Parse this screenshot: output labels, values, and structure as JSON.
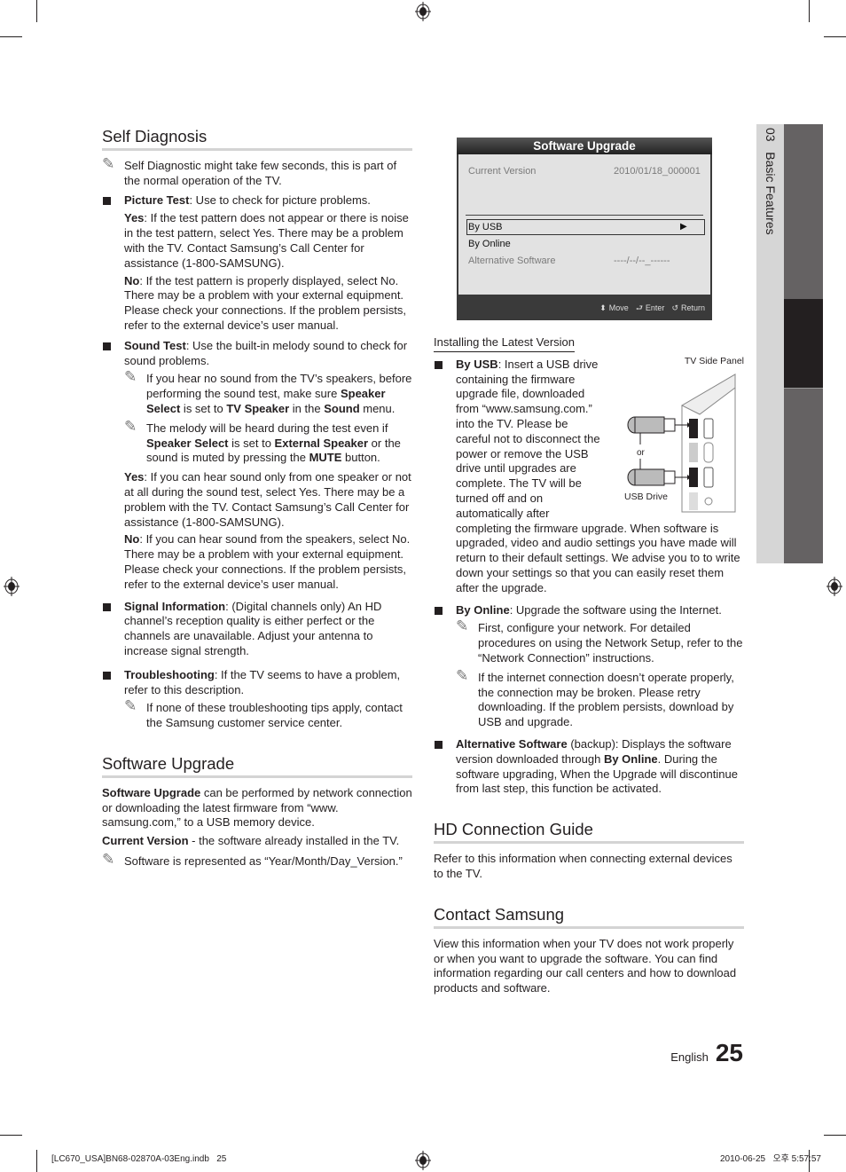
{
  "side_tab": {
    "chapter": "03",
    "title": "Basic Features"
  },
  "self_diagnosis": {
    "heading": "Self Diagnosis",
    "note": "Self Diagnostic might take few seconds, this is part of the normal operation of the TV.",
    "picture_test": {
      "label": "Picture Test",
      "desc": ": Use to check for picture problems.",
      "yes_label": "Yes",
      "yes_text": ": If the test pattern does not appear or there is noise in the test pattern, select Yes. There may be a problem with the TV. Contact Samsung’s Call Center for assistance (1-800-SAMSUNG).",
      "no_label": "No",
      "no_text": ": If the test pattern is properly displayed, select No. There may be a problem with your external equipment. Please check your connections. If the problem persists, refer to the external device’s user manual."
    },
    "sound_test": {
      "label": "Sound Test",
      "desc": ": Use the built-in melody sound to check for sound problems.",
      "note1": {
        "t1": "If you hear no sound from the TV’s speakers, before performing the sound test, make sure ",
        "b1": "Speaker Select",
        "t2": " is set to ",
        "b2": "TV Speaker",
        "t3": " in the ",
        "b3": "Sound",
        "t4": " menu."
      },
      "note2": {
        "t1": "The melody will be heard during the test even if ",
        "b1": "Speaker Select",
        "t2": " is set to ",
        "b2": "External Speaker",
        "t3": " or the sound is muted by pressing the ",
        "b3": "MUTE",
        "t4": " button."
      },
      "yes_label": "Yes",
      "yes_text": ": If you can hear sound only from one speaker or not at all during the sound test, select Yes. There may be a problem with the TV. Contact Samsung’s Call Center for assistance (1-800-SAMSUNG).",
      "no_label": "No",
      "no_text": ": If you can hear sound from the speakers, select No. There may be a problem with your external equipment. Please check your connections. If the problem persists, refer to the external device’s user manual."
    },
    "signal_info": {
      "label": "Signal Information",
      "desc": ": (Digital channels only) An HD channel’s reception quality is either perfect or the channels are unavailable. Adjust your antenna to increase signal strength."
    },
    "troubleshooting": {
      "label": "Troubleshooting",
      "desc": ": If the TV seems to have a problem, refer to this description.",
      "note": "If none of these troubleshooting tips apply, contact the Samsung customer service center."
    }
  },
  "software_upgrade": {
    "heading": "Software Upgrade",
    "intro_bold": "Software Upgrade",
    "intro_text": " can be performed by network connection or downloading the latest firmware from “www. samsung.com,” to a USB memory device.",
    "current_bold": "Current Version",
    "current_text": " - the software already installed in the TV.",
    "note": "Software is represented as “Year/Month/Day_Version.”"
  },
  "osd": {
    "title": "Software Upgrade",
    "current_label": "Current Version",
    "current_value": "2010/01/18_000001",
    "items": [
      {
        "label": "By USB",
        "value": "▶"
      },
      {
        "label": "By Online",
        "value": ""
      },
      {
        "label": "Alternative Software",
        "value": "----/--/--_------"
      }
    ],
    "footer": {
      "move": "Move",
      "enter": "Enter",
      "return": "Return"
    }
  },
  "installing": {
    "subheading": "Installing the Latest Version",
    "diagram": {
      "panel_label": "TV Side Panel",
      "or_label": "or",
      "drive_label": "USB Drive"
    },
    "by_usb": {
      "label": "By USB",
      "text": ": Insert a USB drive containing the firmware upgrade file, downloaded from “www.samsung.com.” into the TV. Please be careful not to disconnect the power or remove the USB drive until upgrades are complete. The TV will be turned off and on automatically after completing the firmware upgrade. When software is upgraded, video and audio settings you have made will return to their default settings. We advise you to to write down your settings so that you can easily reset them after the upgrade."
    },
    "by_online": {
      "label": "By Online",
      "text": ": Upgrade the software using the Internet.",
      "note1": "First, configure your network. For detailed procedures on using the Network Setup, refer to the “Network Connection” instructions.",
      "note2": "If the internet connection doesn’t operate properly, the connection may be broken. Please retry downloading. If the problem persists, download by USB and upgrade."
    },
    "alt_software": {
      "label": "Alternative Software",
      "t1": " (backup): Displays the software version downloaded through ",
      "b1": "By Online",
      "t2": ". During the software upgrading, When the Upgrade will discontinue from last step, this function be activated."
    }
  },
  "hd_guide": {
    "heading": "HD Connection Guide",
    "text": "Refer to this information when connecting external devices to the TV."
  },
  "contact": {
    "heading": "Contact Samsung",
    "text": "View this information when your TV does not work properly or when you want to upgrade the software. You can find information regarding our call centers and how to download products and software."
  },
  "page_footer": {
    "language": "English",
    "page_number": "25"
  },
  "print_info": {
    "file": "[LC670_USA]BN68-02870A-03Eng.indb   25",
    "timestamp": "2010-06-25   오후 5:57:57"
  }
}
